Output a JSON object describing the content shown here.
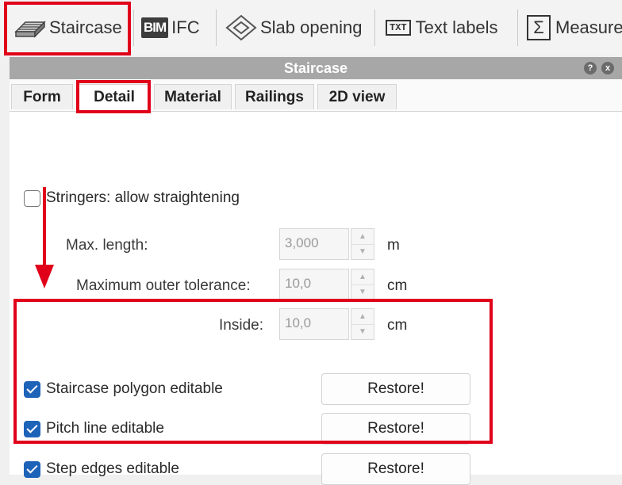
{
  "toolbar": {
    "items": [
      {
        "label": "Staircase",
        "icon": "staircase-icon"
      },
      {
        "label": "IFC",
        "icon": "bim-icon",
        "icon_text": "BIM"
      },
      {
        "label": "Slab opening",
        "icon": "slab-opening-icon"
      },
      {
        "label": "Text labels",
        "icon": "text-labels-icon",
        "icon_text": "TXT"
      },
      {
        "label": "Measure",
        "icon": "sigma-icon",
        "icon_text": "Σ"
      }
    ]
  },
  "panel": {
    "title": "Staircase",
    "help_glyph": "?",
    "close_glyph": "x",
    "tabs": [
      {
        "label": "Form"
      },
      {
        "label": "Detail"
      },
      {
        "label": "Material"
      },
      {
        "label": "Railings"
      },
      {
        "label": "2D view"
      }
    ]
  },
  "detail": {
    "stringers_label": "Stringers: allow straightening",
    "stringers_checked": false,
    "fields": [
      {
        "label": "Max. length:",
        "value": "3,000",
        "unit": "m"
      },
      {
        "label": "Maximum outer tolerance:",
        "value": "10,0",
        "unit": "cm"
      },
      {
        "label": "Inside:",
        "value": "10,0",
        "unit": "cm"
      }
    ],
    "editables": [
      {
        "label": "Staircase polygon editable",
        "checked": true,
        "button": "Restore!"
      },
      {
        "label": "Pitch line editable",
        "checked": true,
        "button": "Restore!"
      },
      {
        "label": "Step edges editable",
        "checked": true,
        "button": "Restore!"
      }
    ]
  },
  "colors": {
    "accent": "#1d63b8",
    "highlight": "#e0001a",
    "titlebar": "#a7a7a7"
  }
}
